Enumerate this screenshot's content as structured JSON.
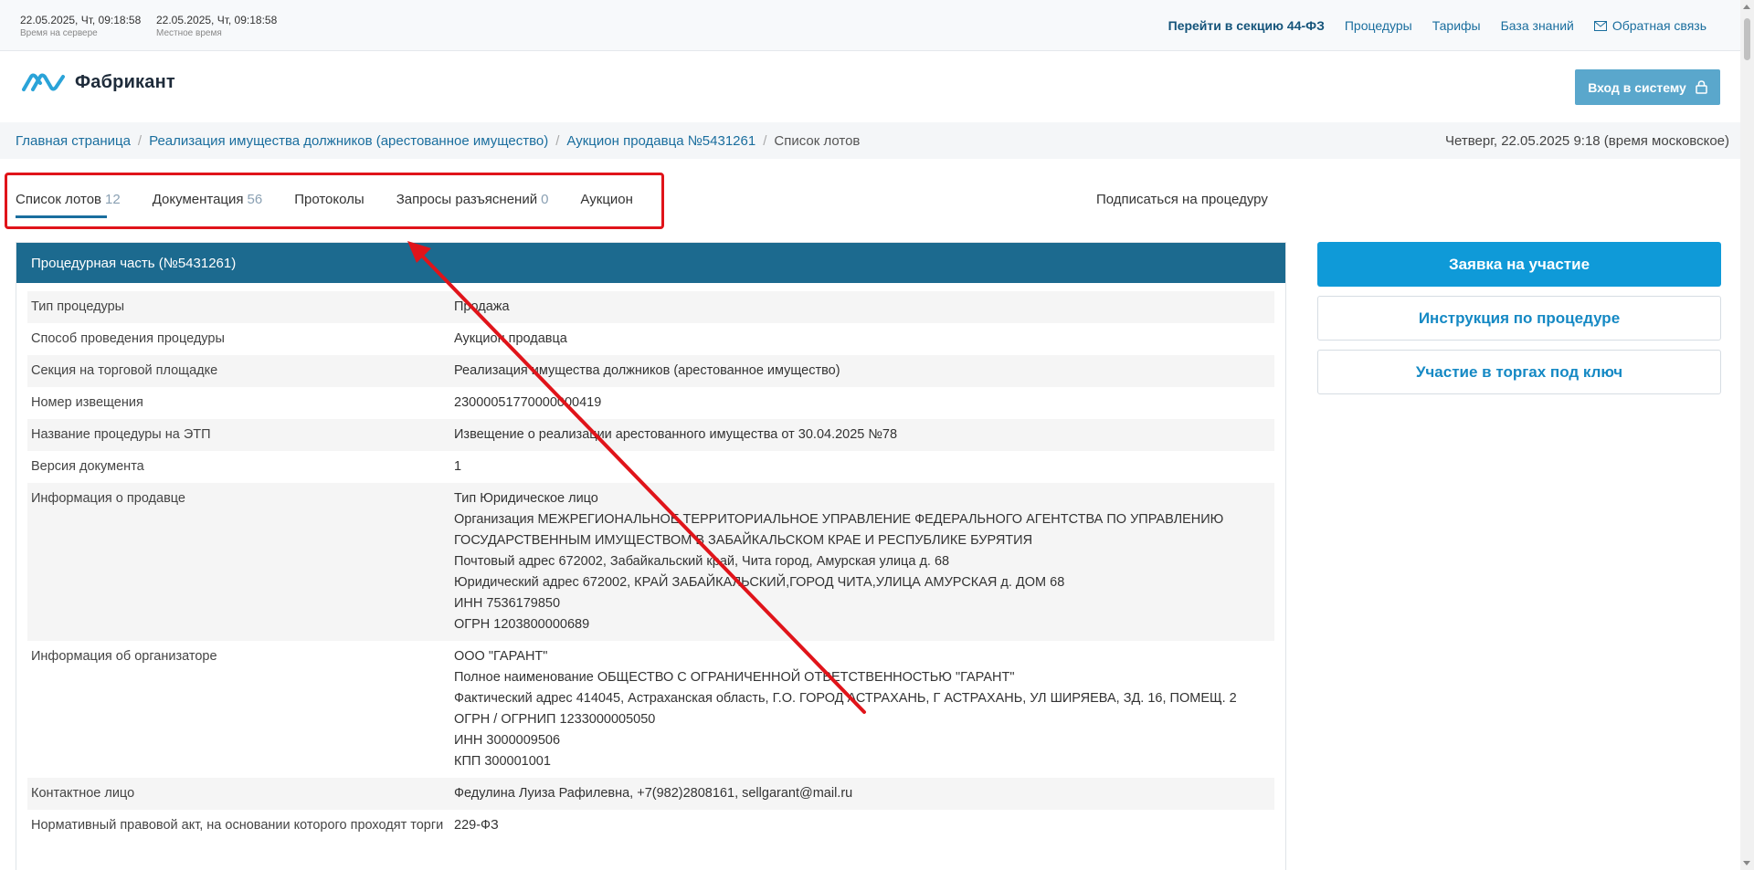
{
  "topbar": {
    "server_time": "22.05.2025, Чт, 09:18:58",
    "server_label": "Время на сервере",
    "local_time": "22.05.2025, Чт, 09:18:58",
    "local_label": "Местное время",
    "nav": [
      "Перейти в секцию 44-ФЗ",
      "Процедуры",
      "Тарифы",
      "База знаний",
      "Обратная связь"
    ]
  },
  "header": {
    "logo_text": "Фабрикант",
    "login_label": "Вход в систему"
  },
  "breadcrumbs": {
    "items": [
      "Главная страница",
      "Реализация имущества должников (арестованное имущество)",
      "Аукцион продавца №5431261",
      "Список лотов"
    ],
    "date": "Четверг, 22.05.2025 9:18 (время московское)"
  },
  "tabs": [
    {
      "label": "Список лотов",
      "count": "12"
    },
    {
      "label": "Документация",
      "count": "56"
    },
    {
      "label": "Протоколы",
      "count": ""
    },
    {
      "label": "Запросы разъяснений",
      "count": "0"
    },
    {
      "label": "Аукцион",
      "count": ""
    }
  ],
  "subscribe_label": "Подписаться на процедуру",
  "panel": {
    "title": "Процедурная часть (№5431261)",
    "rows": [
      {
        "key": "Тип процедуры",
        "lines": [
          "Продажа"
        ]
      },
      {
        "key": "Способ проведения процедуры",
        "lines": [
          "Аукцион продавца"
        ]
      },
      {
        "key": "Секция на торговой площадке",
        "lines": [
          "Реализация имущества должников (арестованное имущество)"
        ]
      },
      {
        "key": "Номер извещения",
        "lines": [
          "23000051770000000419"
        ]
      },
      {
        "key": "Название процедуры на ЭТП",
        "lines": [
          "Извещение о реализации арестованного имущества от 30.04.2025 №78"
        ]
      },
      {
        "key": "Версия документа",
        "lines": [
          "1"
        ]
      },
      {
        "key": "Информация о продавце",
        "lines": [
          "Тип Юридическое лицо",
          "Организация МЕЖРЕГИОНАЛЬНОЕ ТЕРРИТОРИАЛЬНОЕ УПРАВЛЕНИЕ ФЕДЕРАЛЬНОГО АГЕНТСТВА ПО УПРАВЛЕНИЮ",
          "ГОСУДАРСТВЕННЫМ ИМУЩЕСТВОМ В ЗАБАЙКАЛЬСКОМ КРАЕ И РЕСПУБЛИКЕ БУРЯТИЯ",
          "Почтовый адрес 672002, Забайкальский край, Чита город, Амурская улица д. 68",
          "Юридический адрес 672002, КРАЙ ЗАБАЙКАЛЬСКИЙ,ГОРОД ЧИТА,УЛИЦА АМУРСКАЯ д. ДОМ 68",
          "ИНН 7536179850",
          "ОГРН 1203800000689"
        ]
      },
      {
        "key": "Информация об организаторе",
        "lines": [
          "ООО \"ГАРАНТ\"",
          "Полное наименование ОБЩЕСТВО С ОГРАНИЧЕННОЙ ОТВЕТСТВЕННОСТЬЮ \"ГАРАНТ\"",
          "Фактический адрес 414045, Астраханская область, Г.О. ГОРОД АСТРАХАНЬ, Г АСТРАХАНЬ, УЛ ШИРЯЕВА, ЗД. 16, ПОМЕЩ. 2",
          "ОГРН / ОГРНИП 1233000005050",
          "ИНН 3000009506",
          "КПП 300001001"
        ]
      },
      {
        "key": "Контактное лицо",
        "lines": [
          "Федулина Луиза Рафилевна, +7(982)2808161, sellgarant@mail.ru"
        ]
      },
      {
        "key": "Нормативный правовой акт, на основании которого проходят торги",
        "lines": [
          "229-ФЗ"
        ]
      }
    ]
  },
  "side_buttons": {
    "apply": "Заявка на участие",
    "instruction": "Инструкция по процедуре",
    "turnkey": "Участие в торгах под ключ"
  },
  "colors": {
    "accent": "#1c6a8f",
    "primary_button": "#0f9ad8",
    "annotation": "#e0141a"
  }
}
